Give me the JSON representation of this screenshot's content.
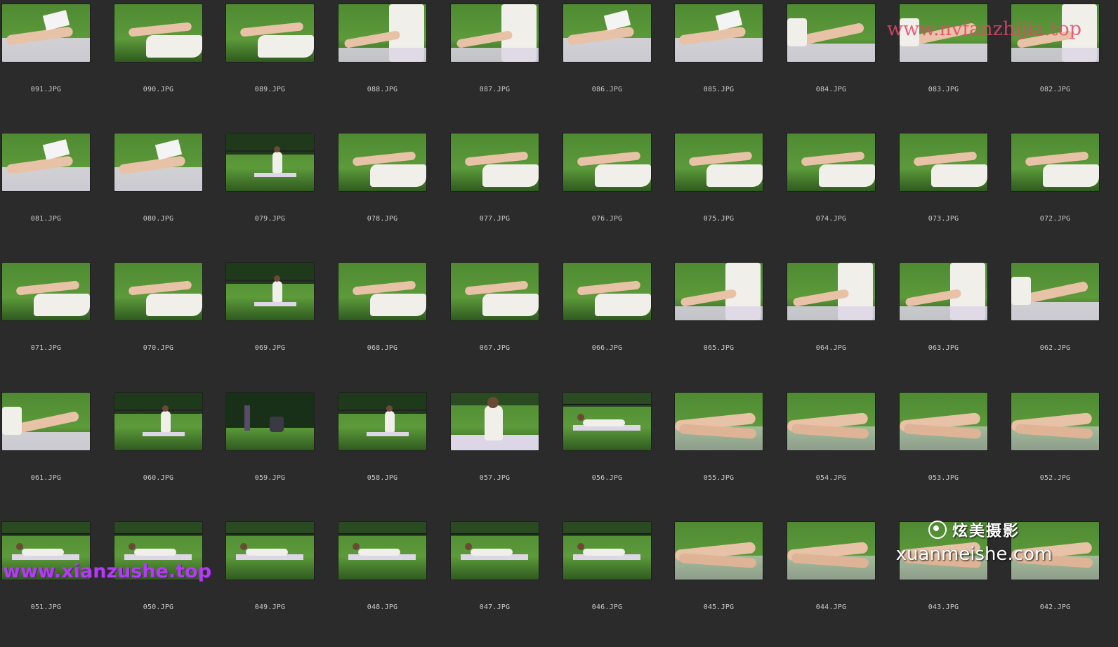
{
  "colors": {
    "background": "#2b2b2b",
    "filename_text": "#c8c8c8",
    "grass": "#4f8a32",
    "grass_dark": "#2f5a1f",
    "skin": "#e8c2a6",
    "dress": "#f1efea",
    "blanket": "#ddd6e6"
  },
  "watermarks": {
    "top_right": "www.nvfanzhijia.top",
    "bottom_left": "www.xianzushe.top",
    "brand_cn": "炫美摄影",
    "brand_en": "xuanmeishe.com"
  },
  "thumbnails": [
    {
      "name": "091.JPG",
      "kind": "closeup-book"
    },
    {
      "name": "090.JPG",
      "kind": "legs-dress"
    },
    {
      "name": "089.JPG",
      "kind": "legs-dress"
    },
    {
      "name": "088.JPG",
      "kind": "sitting-close"
    },
    {
      "name": "087.JPG",
      "kind": "sitting-close"
    },
    {
      "name": "086.JPG",
      "kind": "closeup-book"
    },
    {
      "name": "085.JPG",
      "kind": "closeup-book"
    },
    {
      "name": "084.JPG",
      "kind": "legs-blanket"
    },
    {
      "name": "083.JPG",
      "kind": "legs-blanket"
    },
    {
      "name": "082.JPG",
      "kind": "sitting-close"
    },
    {
      "name": "081.JPG",
      "kind": "closeup-book"
    },
    {
      "name": "080.JPG",
      "kind": "closeup-book"
    },
    {
      "name": "079.JPG",
      "kind": "wide-park"
    },
    {
      "name": "078.JPG",
      "kind": "legs-dress"
    },
    {
      "name": "077.JPG",
      "kind": "legs-dress"
    },
    {
      "name": "076.JPG",
      "kind": "legs-dress"
    },
    {
      "name": "075.JPG",
      "kind": "legs-dress"
    },
    {
      "name": "074.JPG",
      "kind": "legs-dress"
    },
    {
      "name": "073.JPG",
      "kind": "legs-dress"
    },
    {
      "name": "072.JPG",
      "kind": "legs-dress"
    },
    {
      "name": "071.JPG",
      "kind": "legs-dress"
    },
    {
      "name": "070.JPG",
      "kind": "legs-dress"
    },
    {
      "name": "069.JPG",
      "kind": "wide-park"
    },
    {
      "name": "068.JPG",
      "kind": "legs-dress"
    },
    {
      "name": "067.JPG",
      "kind": "legs-dress"
    },
    {
      "name": "066.JPG",
      "kind": "legs-dress"
    },
    {
      "name": "065.JPG",
      "kind": "sitting-close"
    },
    {
      "name": "064.JPG",
      "kind": "sitting-close"
    },
    {
      "name": "063.JPG",
      "kind": "sitting-close"
    },
    {
      "name": "062.JPG",
      "kind": "legs-blanket"
    },
    {
      "name": "061.JPG",
      "kind": "legs-blanket"
    },
    {
      "name": "060.JPG",
      "kind": "wide-park"
    },
    {
      "name": "059.JPG",
      "kind": "wide-dark"
    },
    {
      "name": "058.JPG",
      "kind": "wide-park"
    },
    {
      "name": "057.JPG",
      "kind": "wide-sitting"
    },
    {
      "name": "056.JPG",
      "kind": "wide-lying"
    },
    {
      "name": "055.JPG",
      "kind": "feet-closeup"
    },
    {
      "name": "054.JPG",
      "kind": "feet-closeup"
    },
    {
      "name": "053.JPG",
      "kind": "feet-closeup"
    },
    {
      "name": "052.JPG",
      "kind": "feet-closeup"
    },
    {
      "name": "051.JPG",
      "kind": "wide-lying"
    },
    {
      "name": "050.JPG",
      "kind": "wide-lying"
    },
    {
      "name": "049.JPG",
      "kind": "wide-lying"
    },
    {
      "name": "048.JPG",
      "kind": "wide-lying"
    },
    {
      "name": "047.JPG",
      "kind": "wide-lying"
    },
    {
      "name": "046.JPG",
      "kind": "wide-lying"
    },
    {
      "name": "045.JPG",
      "kind": "feet-closeup"
    },
    {
      "name": "044.JPG",
      "kind": "feet-closeup"
    },
    {
      "name": "043.JPG",
      "kind": "feet-closeup"
    },
    {
      "name": "042.JPG",
      "kind": "feet-closeup"
    }
  ]
}
